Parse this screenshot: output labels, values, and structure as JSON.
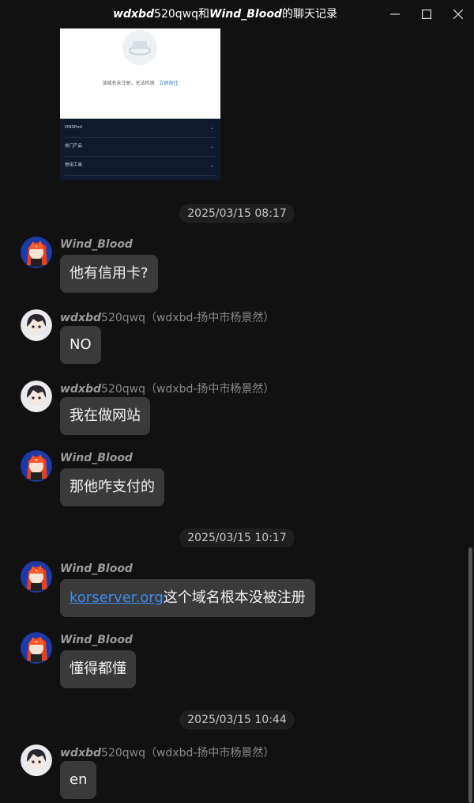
{
  "window": {
    "title_a": "wdxbd",
    "title_b": "520qwq和",
    "title_c": "Wind_Blood",
    "title_d": "的聊天记录"
  },
  "shared_image": {
    "notice": "该域名未注册，无法检测",
    "notice_link": "立即前往",
    "nav": [
      "DNSPod",
      "热门产品",
      "常用工具"
    ]
  },
  "timestamps": [
    "2025/03/15 08:17",
    "2025/03/15 10:17",
    "2025/03/15 10:44"
  ],
  "messages": [
    {
      "nick": "Wind_Blood",
      "extra": "",
      "text": "他有信用卡?"
    },
    {
      "nick": "wdxbd",
      "suffix": "520qwq",
      "extra": "（wdxbd-扬中市杨景然）",
      "text": "NO"
    },
    {
      "nick": "wdxbd",
      "suffix": "520qwq",
      "extra": "（wdxbd-扬中市杨景然）",
      "text": "我在做网站"
    },
    {
      "nick": "Wind_Blood",
      "extra": "",
      "text": "那他咋支付的"
    },
    {
      "nick": "Wind_Blood",
      "extra": "",
      "link": "korserver.org",
      "text": "这个域名根本没被注册"
    },
    {
      "nick": "Wind_Blood",
      "extra": "",
      "text": "懂得都懂"
    },
    {
      "nick": "wdxbd",
      "suffix": "520qwq",
      "extra": "（wdxbd-扬中市杨景然）",
      "text": "en"
    }
  ],
  "icons": {
    "minimize": "minimize-icon",
    "maximize": "maximize-icon",
    "close": "close-icon"
  }
}
